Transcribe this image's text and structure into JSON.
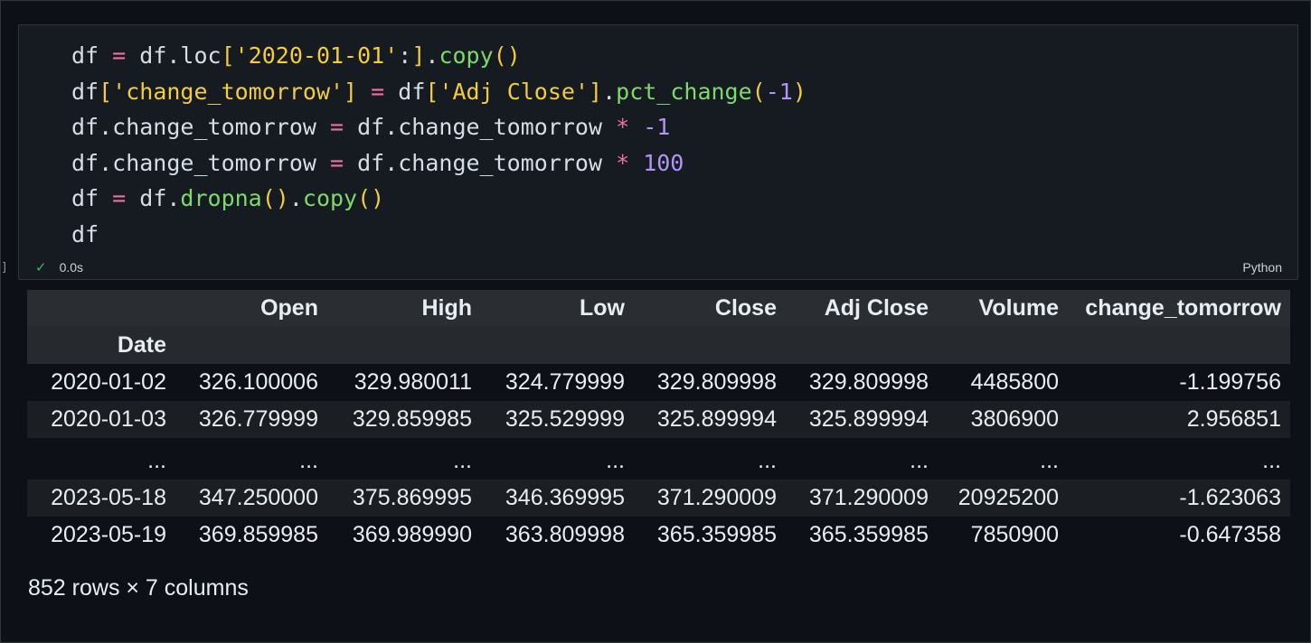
{
  "cell": {
    "marker": "]",
    "code_lines": [
      [
        {
          "t": "df",
          "c": "id"
        },
        {
          "t": " = ",
          "c": "op"
        },
        {
          "t": "df.loc",
          "c": "id"
        },
        {
          "t": "[",
          "c": "br"
        },
        {
          "t": "'2020-01-01'",
          "c": "str"
        },
        {
          "t": ":",
          "c": "id"
        },
        {
          "t": "]",
          "c": "br"
        },
        {
          "t": ".",
          "c": "id"
        },
        {
          "t": "copy",
          "c": "fn"
        },
        {
          "t": "()",
          "c": "br"
        }
      ],
      [
        {
          "t": "df",
          "c": "id"
        },
        {
          "t": "[",
          "c": "br"
        },
        {
          "t": "'change_tomorrow'",
          "c": "str"
        },
        {
          "t": "]",
          "c": "br"
        },
        {
          "t": " = ",
          "c": "op"
        },
        {
          "t": "df",
          "c": "id"
        },
        {
          "t": "[",
          "c": "br"
        },
        {
          "t": "'Adj Close'",
          "c": "str"
        },
        {
          "t": "]",
          "c": "br"
        },
        {
          "t": ".",
          "c": "id"
        },
        {
          "t": "pct_change",
          "c": "fn"
        },
        {
          "t": "(",
          "c": "br"
        },
        {
          "t": "-1",
          "c": "num"
        },
        {
          "t": ")",
          "c": "br"
        }
      ],
      [
        {
          "t": "df.change_tomorrow",
          "c": "id"
        },
        {
          "t": " = ",
          "c": "op"
        },
        {
          "t": "df.change_tomorrow ",
          "c": "id"
        },
        {
          "t": "*",
          "c": "op"
        },
        {
          "t": " -1",
          "c": "num"
        }
      ],
      [
        {
          "t": "df.change_tomorrow",
          "c": "id"
        },
        {
          "t": " = ",
          "c": "op"
        },
        {
          "t": "df.change_tomorrow ",
          "c": "id"
        },
        {
          "t": "*",
          "c": "op"
        },
        {
          "t": " 100",
          "c": "num"
        }
      ],
      [
        {
          "t": "df",
          "c": "id"
        },
        {
          "t": " = ",
          "c": "op"
        },
        {
          "t": "df.",
          "c": "id"
        },
        {
          "t": "dropna",
          "c": "fn"
        },
        {
          "t": "()",
          "c": "br"
        },
        {
          "t": ".",
          "c": "id"
        },
        {
          "t": "copy",
          "c": "fn"
        },
        {
          "t": "()",
          "c": "br"
        }
      ],
      [
        {
          "t": "df",
          "c": "id"
        }
      ]
    ],
    "status_icon": "check-icon",
    "exec_time": "0.0s",
    "language": "Python"
  },
  "output": {
    "columns": [
      "Open",
      "High",
      "Low",
      "Close",
      "Adj Close",
      "Volume",
      "change_tomorrow"
    ],
    "index_name": "Date",
    "rows": [
      {
        "index": "2020-01-02",
        "values": [
          "326.100006",
          "329.980011",
          "324.779999",
          "329.809998",
          "329.809998",
          "4485800",
          "-1.199756"
        ]
      },
      {
        "index": "2020-01-03",
        "values": [
          "326.779999",
          "329.859985",
          "325.529999",
          "325.899994",
          "325.899994",
          "3806900",
          "2.956851"
        ]
      },
      {
        "index": "...",
        "values": [
          "...",
          "...",
          "...",
          "...",
          "...",
          "...",
          "..."
        ]
      },
      {
        "index": "2023-05-18",
        "values": [
          "347.250000",
          "375.869995",
          "346.369995",
          "371.290009",
          "371.290009",
          "20925200",
          "-1.623063"
        ]
      },
      {
        "index": "2023-05-19",
        "values": [
          "369.859985",
          "369.989990",
          "363.809998",
          "365.359985",
          "365.359985",
          "7850900",
          "-0.647358"
        ]
      }
    ],
    "summary": "852 rows × 7 columns"
  }
}
